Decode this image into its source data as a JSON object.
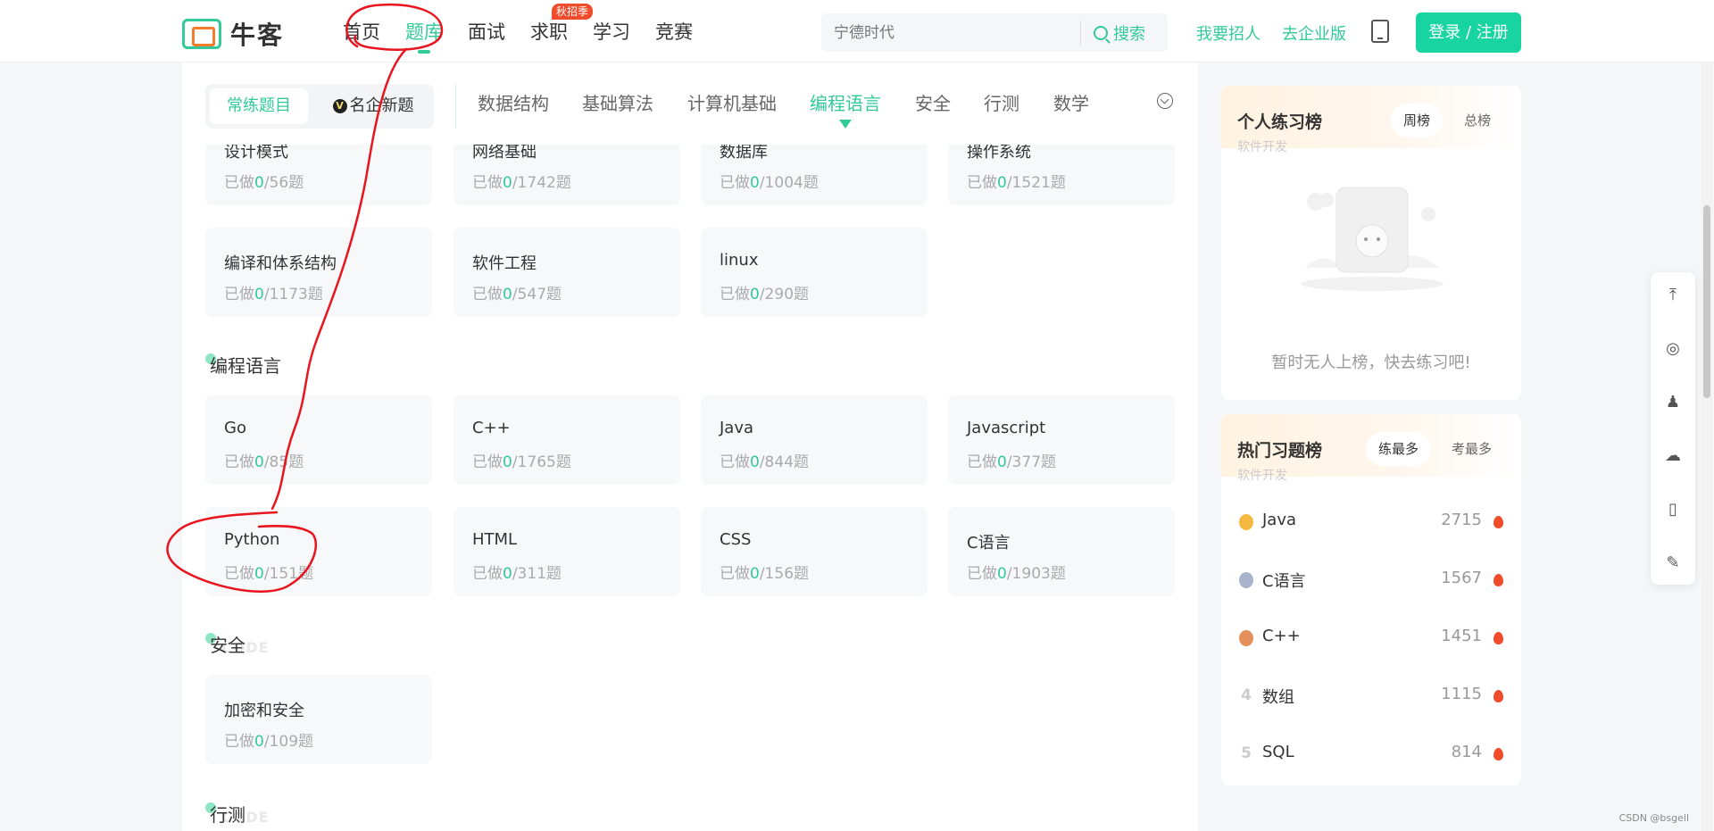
{
  "header": {
    "logo_text": "牛客",
    "nav": [
      {
        "label": "首页",
        "active": false
      },
      {
        "label": "题库",
        "active": true
      },
      {
        "label": "面试",
        "active": false
      },
      {
        "label": "求职",
        "active": false,
        "badge": "秋招季"
      },
      {
        "label": "学习",
        "active": false
      },
      {
        "label": "竞赛",
        "active": false
      }
    ],
    "search_placeholder": "宁德时代",
    "search_button": "搜索",
    "recruit_link": "我要招人",
    "enterprise_link": "去企业版",
    "login_button": "登录 / 注册",
    "accent_color": "#32ca99"
  },
  "filter": {
    "segments": [
      "常练题目",
      "名企新题"
    ],
    "selected_segment": "常练题目",
    "categories": [
      "数据结构",
      "基础算法",
      "计算机基础",
      "编程语言",
      "安全",
      "行测",
      "数学"
    ],
    "active_category": "编程语言"
  },
  "cut_cards": [
    {
      "title": "设计模式",
      "done": "0",
      "total": "/56题"
    },
    {
      "title": "网络基础",
      "done": "0",
      "total": "/1742题"
    },
    {
      "title": "数据库",
      "done": "0",
      "total": "/1004题"
    },
    {
      "title": "操作系统",
      "done": "0",
      "total": "/1521题"
    }
  ],
  "cs_cards": [
    {
      "title": "编译和体系结构",
      "done": "0",
      "total": "/1173题"
    },
    {
      "title": "软件工程",
      "done": "0",
      "total": "/547题"
    },
    {
      "title": "linux",
      "done": "0",
      "total": "/290题"
    }
  ],
  "progress_prefix": "已做",
  "sections": {
    "lang": {
      "title": "编程语言",
      "cards": [
        {
          "title": "Go",
          "done": "0",
          "total": "/85题"
        },
        {
          "title": "C++",
          "done": "0",
          "total": "/1765题"
        },
        {
          "title": "Java",
          "done": "0",
          "total": "/844题"
        },
        {
          "title": "Javascript",
          "done": "0",
          "total": "/377题"
        },
        {
          "title": "Python",
          "done": "0",
          "total": "/151题"
        },
        {
          "title": "HTML",
          "done": "0",
          "total": "/311题"
        },
        {
          "title": "CSS",
          "done": "0",
          "total": "/156题"
        },
        {
          "title": "C语言",
          "done": "0",
          "total": "/1903题"
        }
      ]
    },
    "security": {
      "title": "安全",
      "bg_text": "CODE",
      "cards": [
        {
          "title": "加密和安全",
          "done": "0",
          "total": "/109题"
        }
      ]
    },
    "aptitude": {
      "title": "行测",
      "bg_text": "CODE"
    }
  },
  "personal_board": {
    "title": "个人练习榜",
    "subtitle": "软件开发",
    "tabs": [
      "周榜",
      "总榜"
    ],
    "selected_tab": "周榜",
    "empty_text": "暂时无人上榜，快去练习吧!"
  },
  "hot_board": {
    "title": "热门习题榜",
    "subtitle": "软件开发",
    "tabs": [
      "练最多",
      "考最多"
    ],
    "selected_tab": "练最多",
    "items": [
      {
        "rank": "1",
        "name": "Java",
        "count": "2715",
        "medal_color": "#f5b942"
      },
      {
        "rank": "2",
        "name": "C语言",
        "count": "1567",
        "medal_color": "#a9b4cc"
      },
      {
        "rank": "3",
        "name": "C++",
        "count": "1451",
        "medal_color": "#e3905a"
      },
      {
        "rank": "4",
        "name": "数组",
        "count": "1115"
      },
      {
        "rank": "5",
        "name": "SQL",
        "count": "814"
      }
    ]
  },
  "float_toolbar": [
    "back-to-top",
    "weibo",
    "qq",
    "wechat",
    "mobile",
    "feedback"
  ],
  "watermark": "CSDN @bsgell"
}
